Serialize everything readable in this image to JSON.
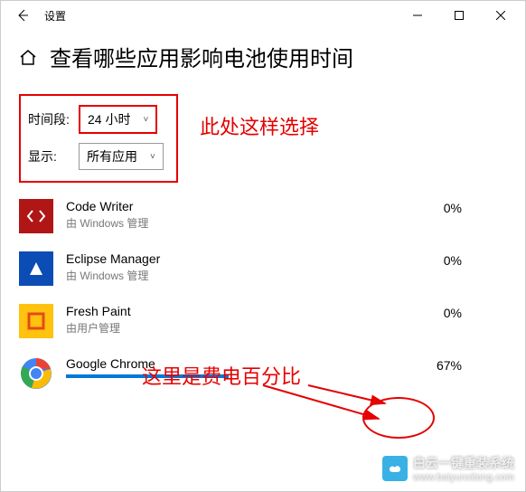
{
  "window": {
    "title": "设置"
  },
  "page": {
    "title": "查看哪些应用影响电池使用时间"
  },
  "filters": {
    "time_label": "时间段:",
    "time_value": "24 小时",
    "show_label": "显示:",
    "show_value": "所有应用"
  },
  "apps": [
    {
      "name": "Code Writer",
      "managed": "由 Windows 管理",
      "percent": "0%"
    },
    {
      "name": "Eclipse Manager",
      "managed": "由 Windows 管理",
      "percent": "0%"
    },
    {
      "name": "Fresh Paint",
      "managed": "由用户管理",
      "percent": "0%"
    },
    {
      "name": "Google Chrome",
      "managed": "",
      "percent": "67%"
    }
  ],
  "annotations": {
    "note1": "此处这样选择",
    "note2": "这里是费电百分比"
  },
  "watermark": {
    "line1": "白云一键重装系统",
    "line2": "www.baiyunxitong.com"
  }
}
